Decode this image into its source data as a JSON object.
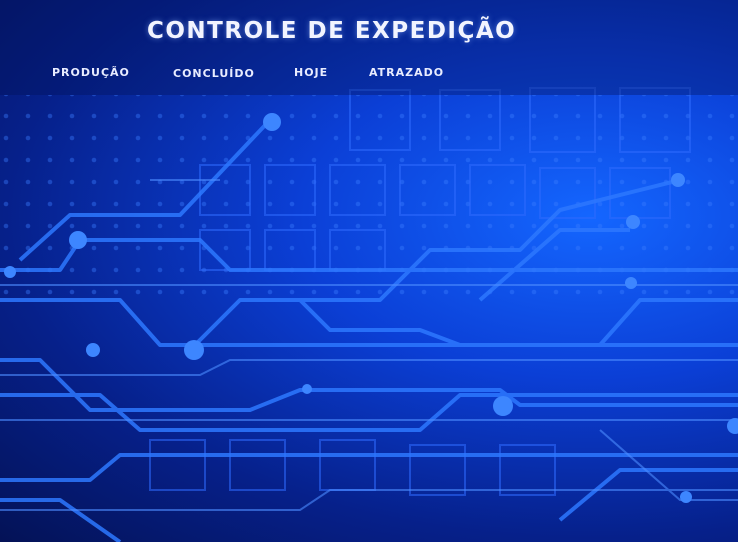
{
  "header": {
    "title": "CONTROLE DE EXPEDIÇÃO"
  },
  "nav": {
    "items": [
      {
        "label": "PRODUÇÃO"
      },
      {
        "label": "CONCLUÍDO"
      },
      {
        "label": "HOJE"
      },
      {
        "label": "ATRAZADO"
      }
    ]
  },
  "theme": {
    "background_dark": "#041256",
    "background_bright": "#1466ff",
    "trace_color": "#2f7bff",
    "text_color": "#f2f4ff"
  }
}
